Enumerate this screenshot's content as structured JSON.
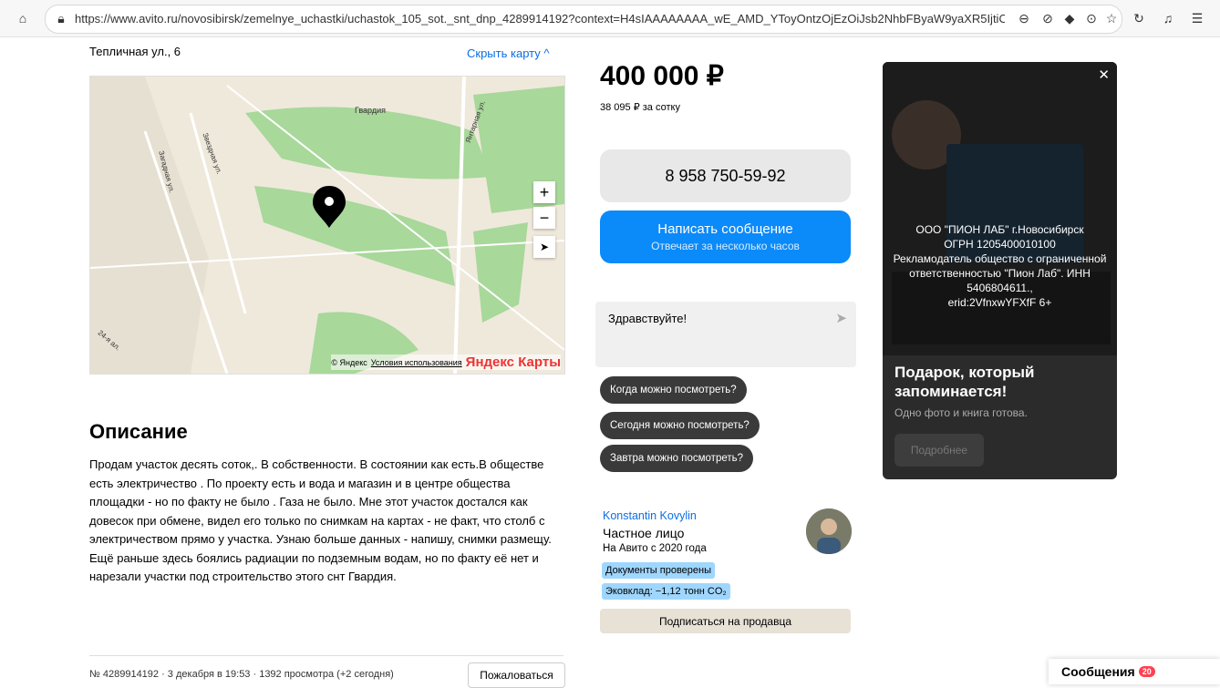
{
  "browser": {
    "url": "https://www.avito.ru/novosibirsk/zemelnye_uchastki/uchastok_105_sot._snt_dnp_4289914192?context=H4sIAAAAAAAA_wE_AMD_YToyOntzOjEzOiJsb2NhbFByaW9yaXR5IjtiOjA7czoxOiJ4IjtzOjE2OiJ"
  },
  "listing": {
    "address": "Тепличная ул., 6",
    "hide_map": "Скрыть карту ^",
    "map": {
      "copyright": "© Яндекс",
      "terms": "Условия использования",
      "brand": "Яндекс Карты",
      "labels": [
        "Гвардия",
        "Загадная ул.",
        "Звездная ул.",
        "Янтарная ул.",
        "24-я ал."
      ]
    },
    "description_title": "Описание",
    "description": "Продам участок десять соток,. В собственности. В состоянии как есть.В обществе есть электричество . По проекту есть и вода и магазин и в центре общества площадки - но по факту не было . Газа не было. Мне этот участок достался как довесок при обмене, видел его только по снимкам на картах - не факт, что столб с электричеством прямо у участка. Узнаю больше данных - напишу, снимки размещу. Ещё раньше здесь боялись радиации по подземным водам, но по факту её нет и нарезали участки под строительство этого снт Гвардия.",
    "meta": "№ 4289914192 · 3 декабря в 19:53 · 1392 просмотра (+2 сегодня)",
    "report_label": "Пожаловаться"
  },
  "sidebar": {
    "price": "400 000 ₽",
    "price_per": "38 095 ₽ за сотку",
    "phone": "8 958 750-59-92",
    "message_button": "Написать сообщение",
    "message_sub": "Отвечает за несколько часов",
    "chat_placeholder": "Здравствуйте!",
    "quick_questions": [
      "Когда можно посмотреть?",
      "Сегодня можно посмотреть?",
      "Завтра можно посмотреть?"
    ],
    "seller": {
      "name": "Konstantin Kovylin",
      "type": "Частное лицо",
      "since": "На Авито с 2020 года",
      "badge_docs": "Документы проверены",
      "badge_eco": "Эковклад: −1,12 тонн CO₂"
    },
    "subscribe": "Подписаться на продавца"
  },
  "ad": {
    "legal": "ООО \"ПИОН ЛАБ\" г.Новосибирск\nОГРН 1205400010100\nРекламодатель общество с ограниченной ответственностью \"Пион Лаб\". ИНН 5406804611.,\nerid:2VfnxwYFXfF 6+",
    "title": "Подарок, который запоминается!",
    "subtitle": "Одно фото и книга готова.",
    "more": "Подробнее"
  },
  "messages_widget": {
    "label": "Сообщения",
    "count": "20"
  }
}
